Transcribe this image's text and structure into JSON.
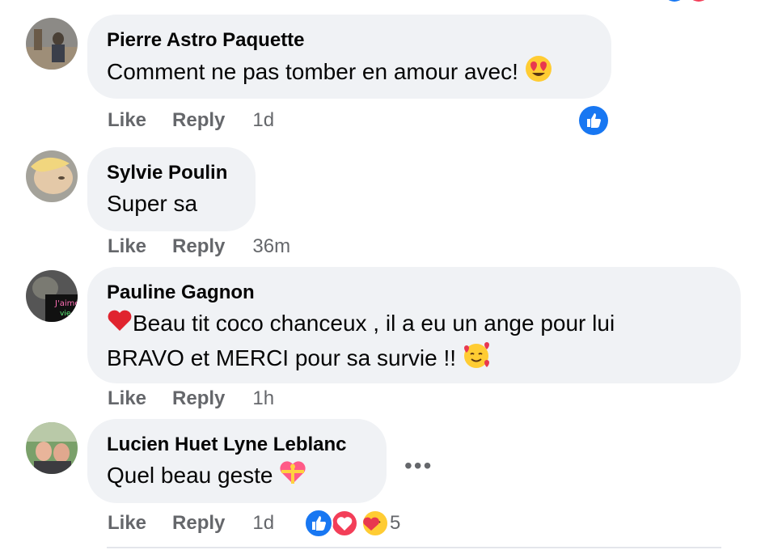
{
  "comments": [
    {
      "author": "Pierre Astro Paquette",
      "text": "Comment ne pas tomber en amour avec!",
      "like": "Like",
      "reply": "Reply",
      "time": "1d"
    },
    {
      "author": "Sylvie Poulin",
      "text": "Super sa",
      "like": "Like",
      "reply": "Reply",
      "time": "36m"
    },
    {
      "author": "Pauline Gagnon",
      "text_line1": "Beau tit coco chanceux , il a eu un ange pour lui",
      "text_line2": "BRAVO et MERCI pour sa survie !!",
      "like": "Like",
      "reply": "Reply",
      "time": "1h"
    },
    {
      "author": "Lucien Huet Lyne Leblanc",
      "text": "Quel beau geste",
      "like": "Like",
      "reply": "Reply",
      "time": "1d",
      "reaction_count": "5"
    }
  ],
  "more_label": "•••",
  "colors": {
    "bubble": "#f0f2f5",
    "meta": "#65676b",
    "like_blue": "#1877f2",
    "love_red": "#f33e58"
  }
}
